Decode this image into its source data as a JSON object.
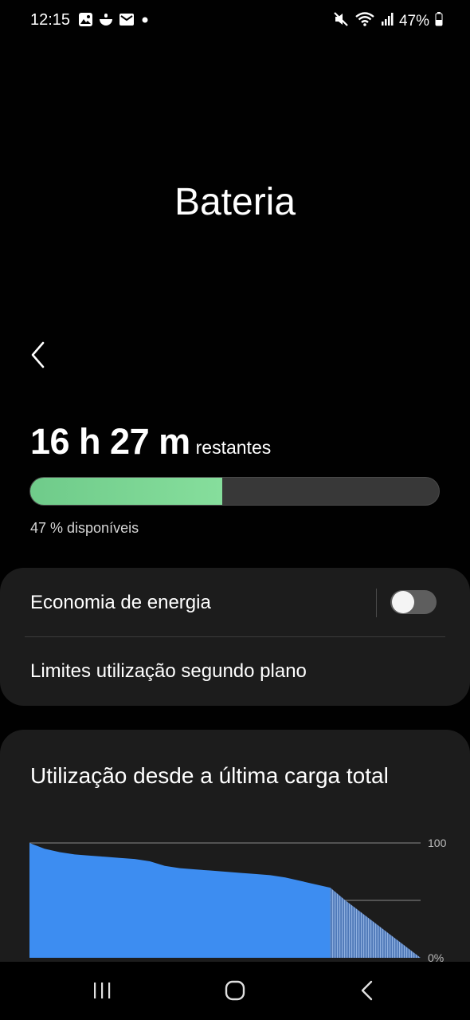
{
  "status_bar": {
    "time": "12:15",
    "battery_percent": "47%",
    "left_icons": [
      "gallery-icon",
      "food-icon",
      "mail-icon",
      "dot-icon"
    ],
    "right_icons": [
      "mute-icon",
      "wifi-icon",
      "signal-icon",
      "battery-icon"
    ]
  },
  "header": {
    "title": "Bateria"
  },
  "battery": {
    "remaining_value": "16 h 27 m",
    "remaining_suffix": "restantes",
    "level": 0.47,
    "available_text": "47 % disponíveis",
    "fill_color": "#7ad593"
  },
  "settings": {
    "power_saving_label": "Economia de energia",
    "power_saving_on": false,
    "background_limits_label": "Limites utilização segundo plano"
  },
  "usage": {
    "title": "Utilização desde a última carga total"
  },
  "chart_data": {
    "type": "area",
    "yticks": [
      "100",
      "0%"
    ],
    "ylim": [
      0,
      100
    ],
    "series": [
      {
        "values": [
          100,
          95,
          92,
          90,
          89,
          88,
          87,
          86,
          84,
          80,
          78,
          77,
          76,
          75,
          74,
          73,
          72,
          70,
          67,
          64,
          61,
          50,
          40,
          30,
          20,
          10,
          0
        ]
      }
    ],
    "actual_points": 21,
    "colors": {
      "actual": "#3d8df1",
      "predicted": "#6f95c8"
    }
  },
  "nav": {
    "icons": [
      "recent-apps-icon",
      "home-icon",
      "back-icon"
    ]
  }
}
